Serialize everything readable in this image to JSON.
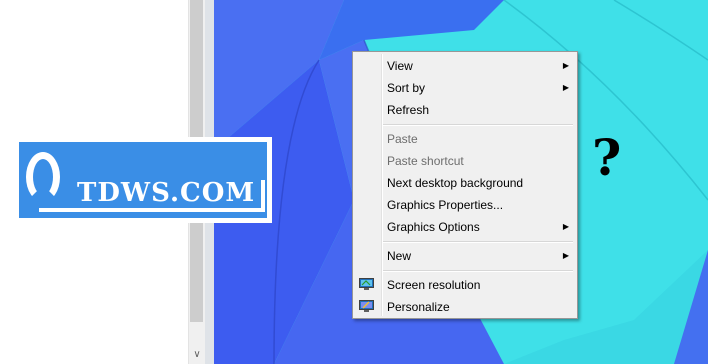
{
  "logo": {
    "text": "TDWS.COM"
  },
  "annotation": {
    "text": "?"
  },
  "context_menu": {
    "items": [
      {
        "label": "View",
        "submenu": true,
        "disabled": false
      },
      {
        "label": "Sort by",
        "submenu": true,
        "disabled": false
      },
      {
        "label": "Refresh",
        "submenu": false,
        "disabled": false
      },
      {
        "label": "Paste",
        "submenu": false,
        "disabled": true
      },
      {
        "label": "Paste shortcut",
        "submenu": false,
        "disabled": true
      },
      {
        "label": "Next desktop background",
        "submenu": false,
        "disabled": false
      },
      {
        "label": "Graphics Properties...",
        "submenu": false,
        "disabled": false
      },
      {
        "label": "Graphics Options",
        "submenu": true,
        "disabled": false
      },
      {
        "label": "New",
        "submenu": true,
        "disabled": false
      },
      {
        "label": "Screen resolution",
        "submenu": false,
        "disabled": false,
        "icon": "monitor-icon"
      },
      {
        "label": "Personalize",
        "submenu": false,
        "disabled": false,
        "icon": "personalize-monitor-icon"
      }
    ],
    "submenu_arrow": "▶"
  },
  "scrollbar": {
    "down_arrow": "∨"
  },
  "colors": {
    "desktop_cyan": "#3fe0e8",
    "desktop_blue": "#3d5cf0",
    "logo_blue": "#3a8ee6"
  }
}
